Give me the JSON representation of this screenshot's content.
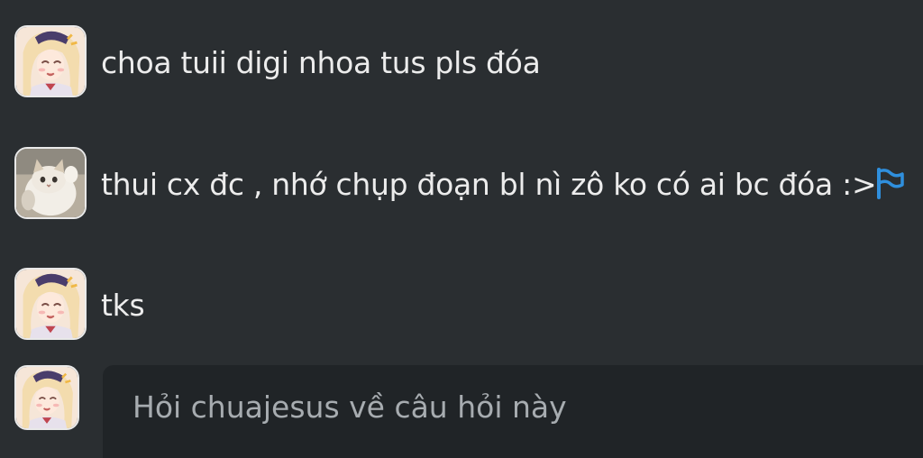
{
  "comments": [
    {
      "avatar": "anime-girl-avatar",
      "text": "choa tuii digi nhoa tus pls đóa"
    },
    {
      "avatar": "cat-avatar",
      "text": "thui cx đc , nhớ chụp đoạn bl nì zô ko có ai bc đóa :>",
      "action_icon": "flag-icon"
    },
    {
      "avatar": "anime-girl-avatar",
      "text": "tks"
    }
  ],
  "reply": {
    "avatar": "anime-girl-avatar",
    "placeholder": "Hỏi chuajesus về câu hỏi này"
  },
  "colors": {
    "background": "#2a2e31",
    "input_background": "#202427",
    "text": "#ececec",
    "placeholder": "#a7acb0",
    "flag": "#2f8fdd"
  }
}
